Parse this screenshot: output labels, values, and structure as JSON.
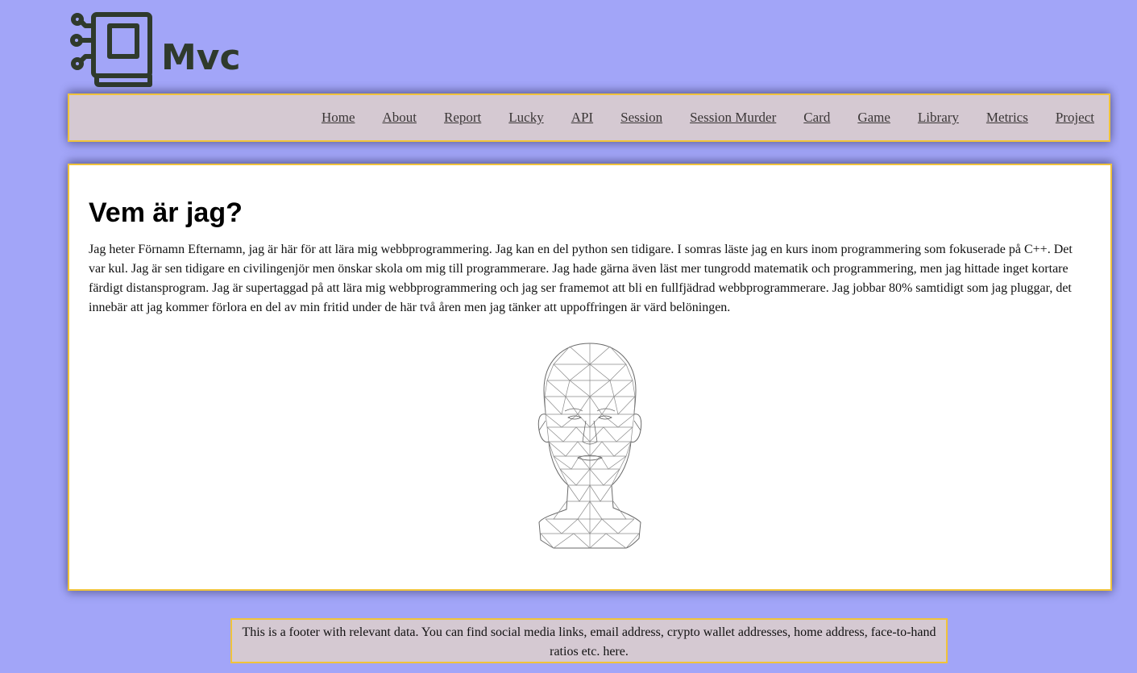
{
  "header": {
    "logo_text": "Mvc",
    "logo_icon": "book-circuit-icon",
    "brand_color": "#2f3a2c"
  },
  "nav": {
    "items": [
      {
        "label": "Home"
      },
      {
        "label": "About"
      },
      {
        "label": "Report"
      },
      {
        "label": "Lucky"
      },
      {
        "label": "API"
      },
      {
        "label": "Session"
      },
      {
        "label": "Session Murder"
      },
      {
        "label": "Card"
      },
      {
        "label": "Game"
      },
      {
        "label": "Library"
      },
      {
        "label": "Metrics"
      },
      {
        "label": "Project"
      }
    ]
  },
  "main": {
    "title": "Vem är jag?",
    "intro": "Jag heter Förnamn Efternamn, jag är här för att lära mig webbprogrammering. Jag kan en del python sen tidigare. I somras läste jag en kurs inom programmering som fokuserade på C++. Det var kul. Jag är sen tidigare en civilingenjör men önskar skola om mig till programmerare. Jag hade gärna även läst mer tungrodd matematik och programmering, men jag hittade inget kortare färdigt distansprogram. Jag är supertaggad på att lära mig webbprogrammering och jag ser framemot att bli en fullfjädrad webbprogrammerare. Jag jobbar 80% samtidigt som jag pluggar, det innebär att jag kommer förlora en del av min fritid under de här två åren men jag tänker att uppoffringen är värd belöningen.",
    "image": "wireframe-head-image"
  },
  "footer": {
    "text": "This is a footer with relevant data. You can find social media links, email address, crypto wallet addresses, home address, face-to-hand ratios etc. here."
  },
  "colors": {
    "background": "#a2a5f8",
    "panel": "#d5c9d2",
    "border": "#f0c33a"
  }
}
